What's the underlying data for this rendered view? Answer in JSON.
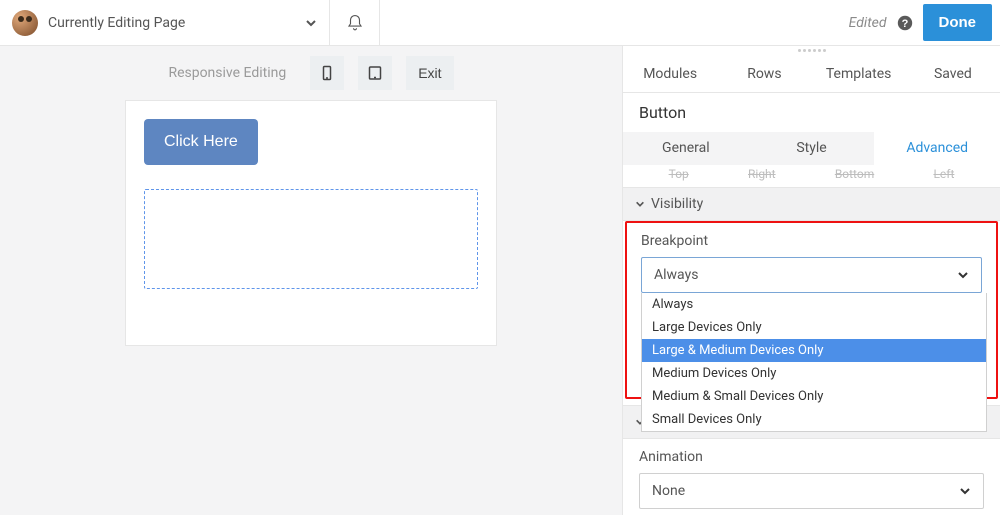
{
  "topbar": {
    "page_title": "Currently Editing Page",
    "edited_label": "Edited",
    "done_label": "Done"
  },
  "responsive_bar": {
    "label": "Responsive Editing",
    "exit_label": "Exit"
  },
  "canvas": {
    "button_label": "Click Here"
  },
  "panel": {
    "tabs": [
      {
        "label": "Modules"
      },
      {
        "label": "Rows"
      },
      {
        "label": "Templates"
      },
      {
        "label": "Saved"
      }
    ],
    "settings_title": "Button",
    "subtabs": [
      {
        "label": "General"
      },
      {
        "label": "Style"
      },
      {
        "label": "Advanced"
      }
    ],
    "spacing_remnant": [
      "Top",
      "Right",
      "Bottom",
      "Left"
    ],
    "visibility": {
      "section_label": "Visibility",
      "breakpoint_label": "Breakpoint",
      "breakpoint_value": "Always",
      "options": [
        "Always",
        "Large Devices Only",
        "Large & Medium Devices Only",
        "Medium Devices Only",
        "Medium & Small Devices Only",
        "Small Devices Only"
      ],
      "highlighted_index": 2
    },
    "animation": {
      "section_label": "Animation",
      "field_label": "Animation",
      "value": "None"
    }
  }
}
